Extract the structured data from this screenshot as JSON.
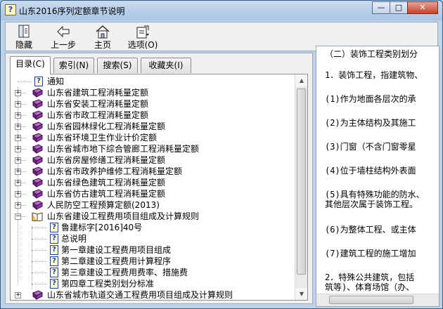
{
  "window": {
    "title": "山东2016序列定额章节说明",
    "title_icon_glyph": "?",
    "controls": {
      "minimize": "—",
      "maximize": "□",
      "close": "✕"
    }
  },
  "toolbar": {
    "hide_label": "隐藏",
    "back_label": "上一步",
    "home_label": "主页",
    "options_label": "选项(O)"
  },
  "tabs": [
    {
      "label": "目录(C)",
      "active": true
    },
    {
      "label": "索引(N)",
      "active": false
    },
    {
      "label": "搜索(S)",
      "active": false
    },
    {
      "label": "收藏夹(I)",
      "active": false
    }
  ],
  "tree": {
    "items": [
      {
        "label": "通知",
        "type": "page"
      },
      {
        "label": "山东省建筑工程消耗量定额",
        "type": "book"
      },
      {
        "label": "山东省安装工程消耗量定额",
        "type": "book"
      },
      {
        "label": "山东省市政工程消耗量定额",
        "type": "book"
      },
      {
        "label": "山东省园林绿化工程消耗量定额",
        "type": "book"
      },
      {
        "label": "山东省环境卫生作业计价定额",
        "type": "book"
      },
      {
        "label": "山东省城市地下综合管廊工程消耗量定额",
        "type": "book"
      },
      {
        "label": "山东省房屋修缮工程消耗量定额",
        "type": "book"
      },
      {
        "label": "山东省市政养护维修工程消耗量定额",
        "type": "book"
      },
      {
        "label": "山东省绿色建筑工程消耗量定额",
        "type": "book"
      },
      {
        "label": "山东省仿古建筑工程消耗量定额",
        "type": "book"
      },
      {
        "label": "人民防空工程预算定额(2013)",
        "type": "book"
      },
      {
        "label": "山东省建设工程费用项目组成及计算规则",
        "type": "open-book"
      },
      {
        "label": "鲁建标字[2016]40号",
        "type": "child-page"
      },
      {
        "label": "总说明",
        "type": "child-page"
      },
      {
        "label": "第一章建设工程费用项目组成",
        "type": "child-page"
      },
      {
        "label": "第二章建设工程费用计算程序",
        "type": "child-page"
      },
      {
        "label": "第三章建设工程费用费率、措施费",
        "type": "child-page"
      },
      {
        "label": "第四章工程类别划分标准",
        "type": "child-page"
      }
    ],
    "partial_item": "山东省城市轨道交通工程费用项目组成及计算规则"
  },
  "content": {
    "lines": [
      "（二）装饰工程类别划分",
      "1．装饰工程，指建筑物、",
      "(1)作为地面各层次的承",
      "(2)为主体结构及其施工",
      "(3)门窗（不含门窗零星",
      "(4)位于墙柱结构外表面",
      "(5)具有特殊功能的防水、",
      "其他层次属于装饰工程。",
      "(6)为整体工程、或主体",
      "(7)建筑工程的施工增加",
      "2．特殊公共建筑，包括",
      "筑等)、体育场馆（办、"
    ]
  },
  "colors": {
    "window_frame": "#bcd3ea",
    "close_button": "#c7412a",
    "book_icon": "#7a2e8c"
  }
}
